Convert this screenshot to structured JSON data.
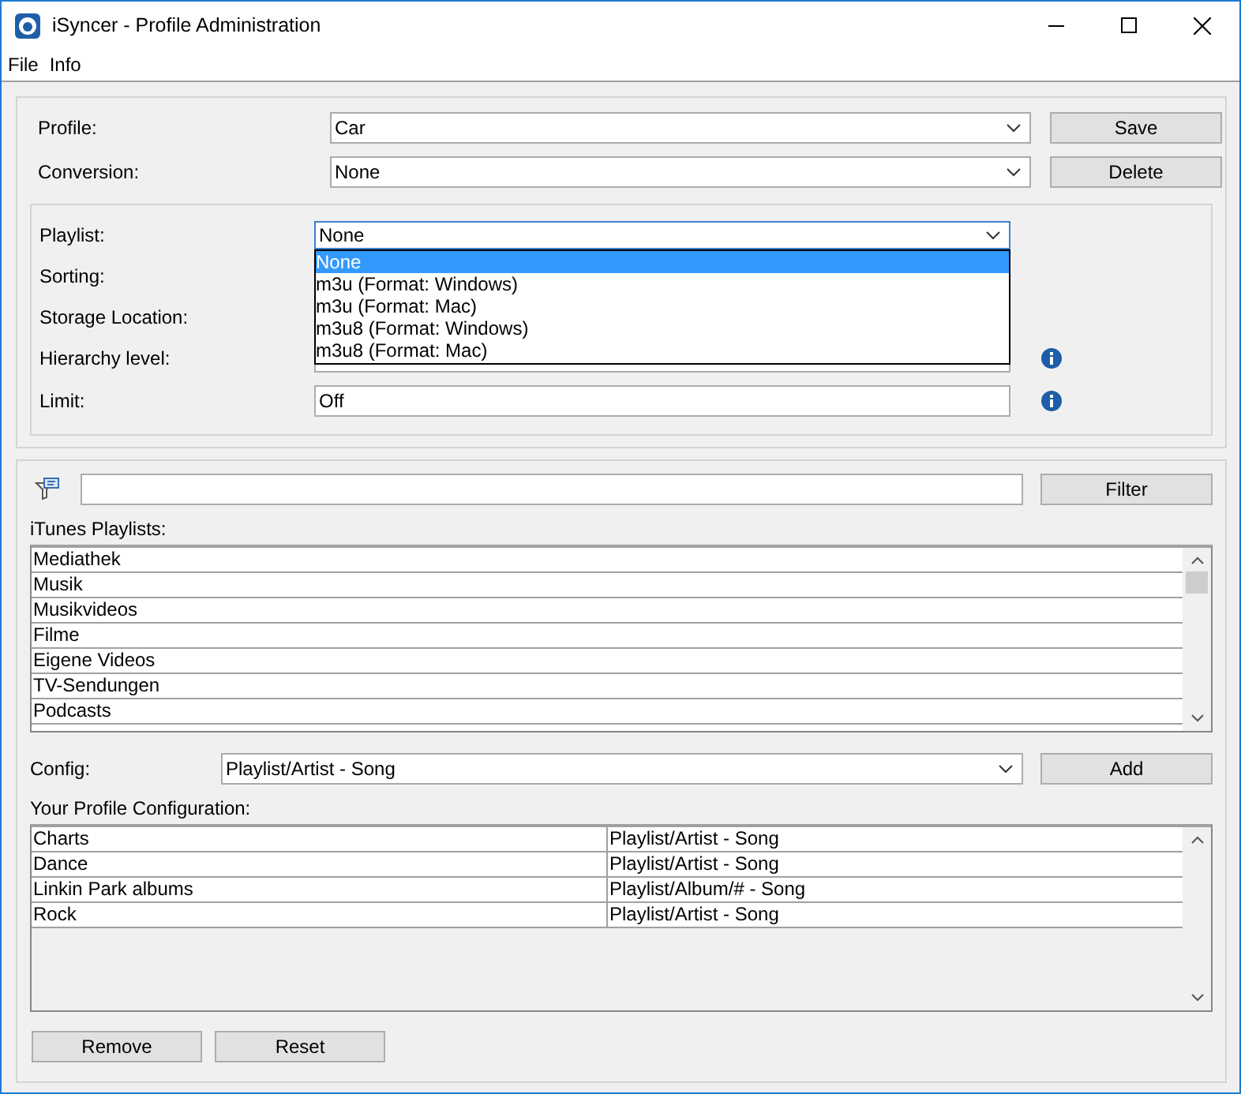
{
  "window": {
    "title": "iSyncer - Profile Administration"
  },
  "menu": [
    "File",
    "Info"
  ],
  "profile_settings": {
    "rows": [
      {
        "label": "Profile:",
        "value": "Car",
        "button": "Save"
      },
      {
        "label": "Conversion:",
        "value": "None",
        "button": "Delete"
      }
    ]
  },
  "playlist_settings": {
    "fields": [
      {
        "label": "Playlist:",
        "kind": "combo",
        "value": "None",
        "info": false,
        "open": true
      },
      {
        "label": "Sorting:",
        "kind": "covered",
        "info": false,
        "open": false
      },
      {
        "label": "Storage Location:",
        "kind": "covered",
        "info": false,
        "open": false
      },
      {
        "label": "Hierarchy level:",
        "kind": "combo",
        "info": true,
        "open": false
      },
      {
        "label": "Limit:",
        "kind": "text",
        "value": "Off",
        "info": true,
        "open": false
      }
    ],
    "dropdown_options": [
      {
        "label": "None",
        "selected": true
      },
      {
        "label": "m3u (Format: Windows)",
        "selected": false
      },
      {
        "label": "m3u (Format: Mac)",
        "selected": false
      },
      {
        "label": "m3u8 (Format: Windows)",
        "selected": false
      },
      {
        "label": "m3u8 (Format: Mac)",
        "selected": false
      }
    ]
  },
  "filter": {
    "button": "Filter"
  },
  "itunes_playlists": {
    "label": "iTunes Playlists:",
    "items": [
      "Mediathek",
      "Musik",
      "Musikvideos",
      "Filme",
      "Eigene Videos",
      "TV-Sendungen",
      "Podcasts"
    ]
  },
  "config": {
    "label": "Config:",
    "value": "Playlist/Artist - Song",
    "button": "Add"
  },
  "profile_configuration": {
    "label": "Your Profile Configuration:",
    "rows": [
      {
        "name": "Charts",
        "structure": "Playlist/Artist - Song"
      },
      {
        "name": "Dance",
        "structure": "Playlist/Artist - Song"
      },
      {
        "name": "Linkin Park albums",
        "structure": "Playlist/Album/# - Song"
      },
      {
        "name": "Rock",
        "structure": "Playlist/Artist - Song"
      }
    ]
  },
  "buttons": [
    "Remove",
    "Reset"
  ]
}
